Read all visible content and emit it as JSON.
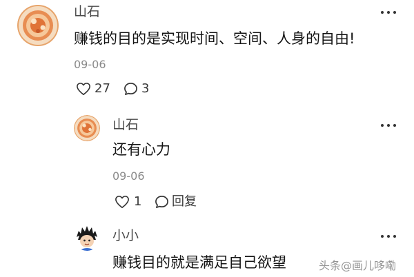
{
  "comments": [
    {
      "author": "山石",
      "text": "赚钱的目的是实现时间、空间、人身的自由!",
      "date": "09-06",
      "likes": "27",
      "replies": "3"
    },
    {
      "author": "山石",
      "text": "还有心力",
      "date": "09-06",
      "likes": "1",
      "reply_label": "回复"
    },
    {
      "author": "小小",
      "text": "赚钱目的就是满足自己欲望"
    }
  ],
  "watermark": "头条@画儿哆嘞",
  "icons": {
    "like": "heart-outline-icon",
    "comment": "speech-bubble-icon",
    "more": "more-dots-icon"
  },
  "colors": {
    "name": "#4a4a4a",
    "text": "#151515",
    "date": "#8a8a8a",
    "avatar_ring": "#e0894a"
  }
}
